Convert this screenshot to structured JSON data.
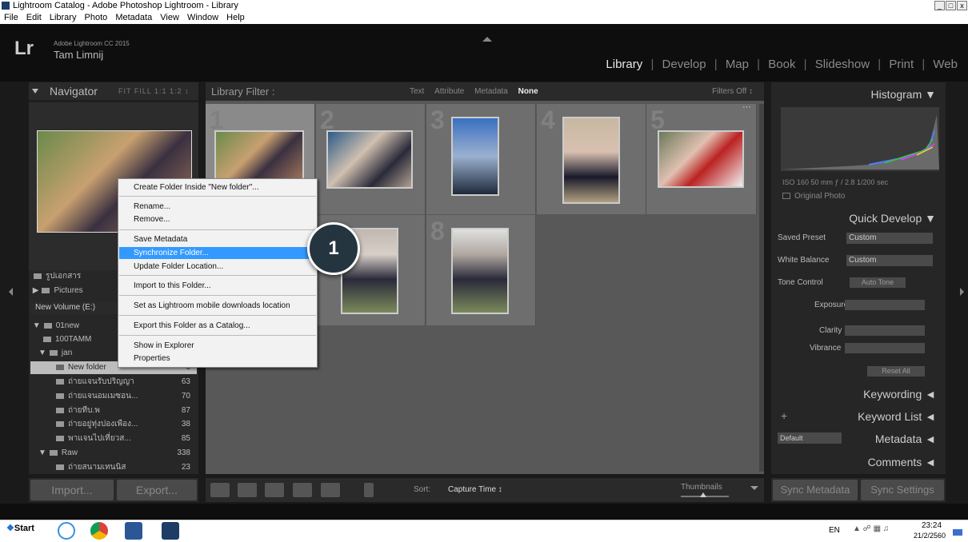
{
  "window": {
    "title": "Lightroom Catalog - Adobe Photoshop Lightroom - Library",
    "minimize": "_",
    "maximize": "□",
    "close": "x"
  },
  "menu": [
    "File",
    "Edit",
    "Library",
    "Photo",
    "Metadata",
    "View",
    "Window",
    "Help"
  ],
  "identity": {
    "logo": "Lr",
    "product": "Adobe Lightroom CC 2015",
    "user": "Tam Limnij"
  },
  "modules": {
    "library": "Library",
    "develop": "Develop",
    "map": "Map",
    "book": "Book",
    "slideshow": "Slideshow",
    "print": "Print",
    "web": "Web",
    "sep": "|"
  },
  "navigator": {
    "title": "Navigator",
    "opts": "FIT  FILL  1:1  1:2 ↕"
  },
  "folders": {
    "rows": [
      {
        "name": "รูปเอกสาร",
        "count": ""
      },
      {
        "name": "Pictures",
        "count": ""
      },
      {
        "name": "New Volume (E:)",
        "count": ""
      },
      {
        "name": "01new",
        "count": ""
      },
      {
        "name": "100TAMM",
        "count": ""
      },
      {
        "name": "jan",
        "count": ""
      },
      {
        "name": "New folder",
        "count": "0"
      },
      {
        "name": "ถ่ายแจนรับปริญญา",
        "count": "63"
      },
      {
        "name": "ถ่ายแจนอมเมซอน...",
        "count": "70"
      },
      {
        "name": "ถ่ายทีบ.พ",
        "count": "87"
      },
      {
        "name": "ถ่ายอยู่ทุ่งปองเพือง...",
        "count": "38"
      },
      {
        "name": "พาแจนไปเที่ยวส...",
        "count": "85"
      },
      {
        "name": "Raw",
        "count": "338"
      },
      {
        "name": "ถ่ายสนามเทนนิส",
        "count": "23"
      }
    ]
  },
  "bottom_left": {
    "import": "Import...",
    "export": "Export..."
  },
  "filter": {
    "label": "Library Filter :",
    "text": "Text",
    "attribute": "Attribute",
    "metadata": "Metadata",
    "none": "None",
    "filters_off": "Filters Off ↕"
  },
  "grid": {
    "numbers": [
      "1",
      "2",
      "3",
      "4",
      "5",
      "",
      "",
      "8"
    ],
    "more": "···"
  },
  "toolbar": {
    "sort_label": "Sort:",
    "sort_value": "Capture Time ↕",
    "thumbnails": "Thumbnails"
  },
  "right": {
    "histogram": "Histogram ▼",
    "hist_info": "ISO 160      50 mm     ƒ / 2.8    1/200 sec",
    "original_photo": "Original Photo",
    "quick_develop": "Quick Develop ▼",
    "saved_preset": "Saved Preset",
    "saved_preset_val": "Custom",
    "white_balance": "White Balance",
    "white_balance_val": "Custom",
    "tone_control": "Tone Control",
    "auto_tone": "Auto Tone",
    "exposure": "Exposure",
    "clarity": "Clarity",
    "vibrance": "Vibrance",
    "reset_all": "Reset All",
    "keywording": "Keywording ◄",
    "keyword_list": "Keyword List ◄",
    "plus": "+",
    "metadata_default": "Default",
    "metadata": "Metadata ◄",
    "comments": "Comments ◄",
    "sync_metadata": "Sync Metadata",
    "sync_settings": "Sync Settings"
  },
  "context_menu": [
    "Create Folder Inside \"New folder\"...",
    "Rename...",
    "Remove...",
    "Save Metadata",
    "Synchronize Folder...",
    "Update Folder Location...",
    "Import to this Folder...",
    "Set as Lightroom mobile downloads location",
    "Export this Folder as a Catalog...",
    "Show in Explorer",
    "Properties"
  ],
  "badge": "1",
  "taskbar": {
    "start": "Start",
    "lang": "EN",
    "time": "23:24",
    "date": "21/2/2560"
  },
  "colors": {
    "accent_highlight": "#3399ff",
    "badge_bg": "#243540"
  }
}
